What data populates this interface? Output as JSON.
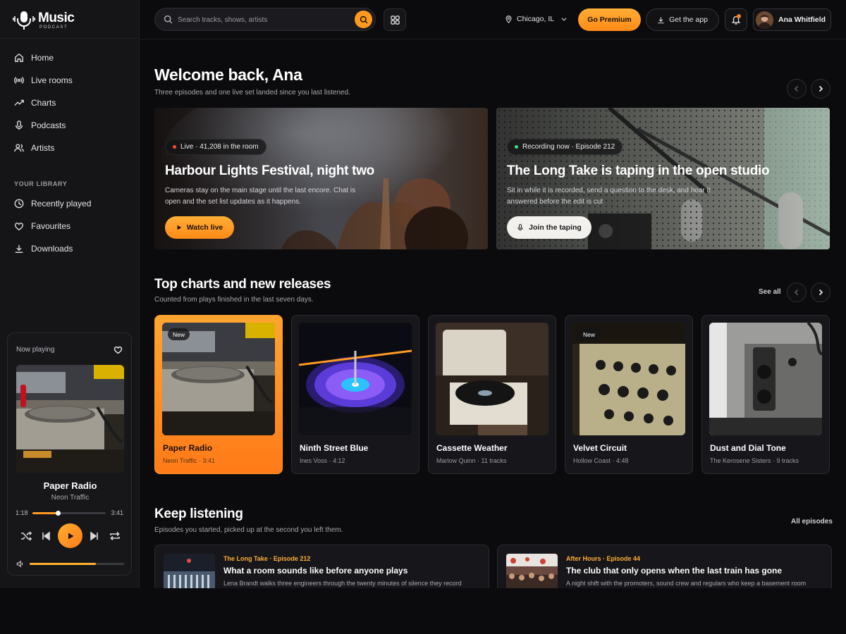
{
  "brand": {
    "name": "Music",
    "tagline": "PODCAST"
  },
  "sidebar": {
    "nav": [
      {
        "label": "Home",
        "icon": "home-icon"
      },
      {
        "label": "Live rooms",
        "icon": "broadcast-icon"
      },
      {
        "label": "Charts",
        "icon": "trending-icon"
      },
      {
        "label": "Podcasts",
        "icon": "mic-icon"
      },
      {
        "label": "Artists",
        "icon": "users-icon"
      }
    ],
    "library_title": "YOUR LIBRARY",
    "library": [
      {
        "label": "Recently played",
        "icon": "clock-icon"
      },
      {
        "label": "Favourites",
        "icon": "heart-icon"
      },
      {
        "label": "Downloads",
        "icon": "download-icon"
      }
    ]
  },
  "now_playing": {
    "heading": "Now playing",
    "title": "Paper Radio",
    "artist": "Neon Traffic",
    "elapsed": "1:18",
    "duration": "3:41",
    "progress": 0.35,
    "volume": 0.7
  },
  "header": {
    "search_placeholder": "Search tracks, shows, artists",
    "location": "Chicago, IL",
    "premium_label": "Go Premium",
    "app_label": "Get the app",
    "user_name": "Ana Whitfield"
  },
  "welcome": {
    "title": "Welcome back, Ana",
    "subtitle": "Three episodes and one live set landed since you last listened."
  },
  "heroes": [
    {
      "pill": "Live · 41,208 in the room",
      "pill_color": "#ff4b3a",
      "title": "Harbour Lights Festival, night two",
      "desc": "Cameras stay on the main stage until the last encore. Chat is open and the set list updates as it happens.",
      "button": "Watch live"
    },
    {
      "pill": "Recording now · Episode 212",
      "pill_color": "#3ddc84",
      "title": "The Long Take is taping in the open studio",
      "desc": "Sit in while it is recorded, send a question to the desk, and hear it answered before the edit is cut",
      "button": "Join the taping"
    }
  ],
  "charts": {
    "title": "Top charts and new releases",
    "subtitle": "Counted from plays finished in the last seven days.",
    "see_all": "See all",
    "cards": [
      {
        "title": "Paper Radio",
        "meta": "Neon Traffic · 3:41",
        "badge": "New"
      },
      {
        "title": "Ninth Street Blue",
        "meta": "Ines Voss · 4:12",
        "badge": ""
      },
      {
        "title": "Cassette Weather",
        "meta": "Marlow Quinn · 11 tracks",
        "badge": ""
      },
      {
        "title": "Velvet Circuit",
        "meta": "Hollow Coast · 4:48",
        "badge": "New"
      },
      {
        "title": "Dust and Dial Tone",
        "meta": "The Kerosene Sisters · 9 tracks",
        "badge": ""
      }
    ]
  },
  "keep_listening": {
    "title": "Keep listening",
    "subtitle": "Episodes you started, picked up at the second you left them.",
    "all_label": "All episodes",
    "episodes": [
      {
        "show": "The Long Take · Episode 212",
        "title": "What a room sounds like before anyone plays",
        "desc": "Lena Brandt walks three engineers through the twenty minutes of silence they record"
      },
      {
        "show": "After Hours · Episode 44",
        "title": "The club that only opens when the last train has gone",
        "desc": "A night shift with the promoters, sound crew and regulars who keep a basement room"
      }
    ]
  },
  "colors": {
    "accent": "#ff9a1f",
    "accent_dark": "#ff7a18",
    "background": "#0b0b0d",
    "panel": "#151518"
  }
}
